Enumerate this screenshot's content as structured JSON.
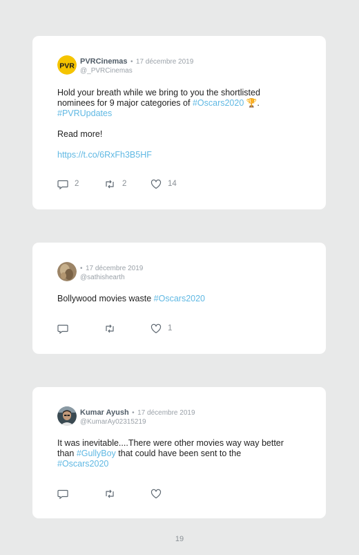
{
  "tweets": [
    {
      "avatar_label": "PVR",
      "name": "PVRCinemas",
      "separator": "•",
      "date": "17 décembre 2019",
      "handle": "@_PVRCinemas",
      "text_line1": "Hold your breath while we bring to you the shortlisted",
      "text_line2_pre": "nominees for 9 major categories of ",
      "hashtag1": "#Oscars2020",
      "emoji": "🏆",
      "period": ".",
      "hashtag2": "#PVRUpdates",
      "read_more": "Read more!",
      "url": "https://t.co/6RxFh3B5HF",
      "replies": "2",
      "retweets": "2",
      "likes": "14"
    },
    {
      "name": "",
      "separator": "•",
      "date": "17 décembre 2019",
      "handle": "@sathishearth",
      "text_pre": "Bollywood movies waste ",
      "hashtag1": "#Oscars2020",
      "likes": "1"
    },
    {
      "name": "Kumar Ayush",
      "separator": "•",
      "date": "17 décembre 2019",
      "handle": "@KumarAy02315219",
      "text_line1": "It was inevitable....There were other movies way way better",
      "text_line2_pre": "than ",
      "hashtag1": "#GullyBoy",
      "text_line2_post": " that could have been sent to the",
      "hashtag2": "#Oscars2020"
    }
  ],
  "page_number": "19",
  "colors": {
    "background": "#e8e9e9",
    "card": "#ffffff",
    "link": "#5fb8e3",
    "muted": "#9aa1a8",
    "pvr_yellow": "#f5c400"
  },
  "icons": [
    "reply-icon",
    "retweet-icon",
    "like-icon"
  ]
}
